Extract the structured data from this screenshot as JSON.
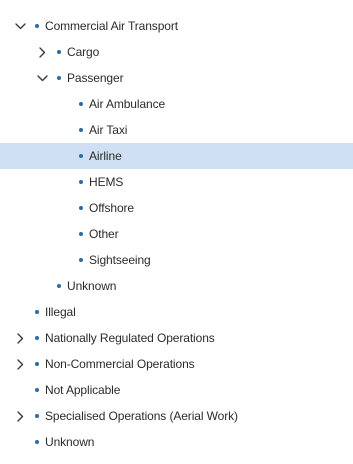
{
  "tree": {
    "items": [
      {
        "label": "Commercial Air Transport",
        "level": 0,
        "toggle": "expanded",
        "selected": false
      },
      {
        "label": "Cargo",
        "level": 1,
        "toggle": "collapsed",
        "selected": false
      },
      {
        "label": "Passenger",
        "level": 1,
        "toggle": "expanded",
        "selected": false
      },
      {
        "label": "Air Ambulance",
        "level": 2,
        "toggle": "none",
        "selected": false
      },
      {
        "label": "Air Taxi",
        "level": 2,
        "toggle": "none",
        "selected": false
      },
      {
        "label": "Airline",
        "level": 2,
        "toggle": "none",
        "selected": true
      },
      {
        "label": "HEMS",
        "level": 2,
        "toggle": "none",
        "selected": false
      },
      {
        "label": "Offshore",
        "level": 2,
        "toggle": "none",
        "selected": false
      },
      {
        "label": "Other",
        "level": 2,
        "toggle": "none",
        "selected": false
      },
      {
        "label": "Sightseeing",
        "level": 2,
        "toggle": "none",
        "selected": false
      },
      {
        "label": "Unknown",
        "level": 1,
        "toggle": "none",
        "selected": false
      },
      {
        "label": "Illegal",
        "level": 0,
        "toggle": "none",
        "selected": false
      },
      {
        "label": "Nationally Regulated Operations",
        "level": 0,
        "toggle": "collapsed",
        "selected": false
      },
      {
        "label": "Non-Commercial Operations",
        "level": 0,
        "toggle": "collapsed",
        "selected": false
      },
      {
        "label": "Not Applicable",
        "level": 0,
        "toggle": "none",
        "selected": false
      },
      {
        "label": "Specialised Operations (Aerial Work)",
        "level": 0,
        "toggle": "collapsed",
        "selected": false
      },
      {
        "label": "Unknown",
        "level": 0,
        "toggle": "none",
        "selected": false
      }
    ]
  },
  "colors": {
    "bullet": "#2d6aa6",
    "chevron": "#3a3a3a",
    "selected_background": "#cfe0f4",
    "text": "#2b2b2b"
  },
  "icons": {
    "expanded": "chevron-down-icon",
    "collapsed": "chevron-right-icon",
    "bullet": "bullet-icon"
  }
}
